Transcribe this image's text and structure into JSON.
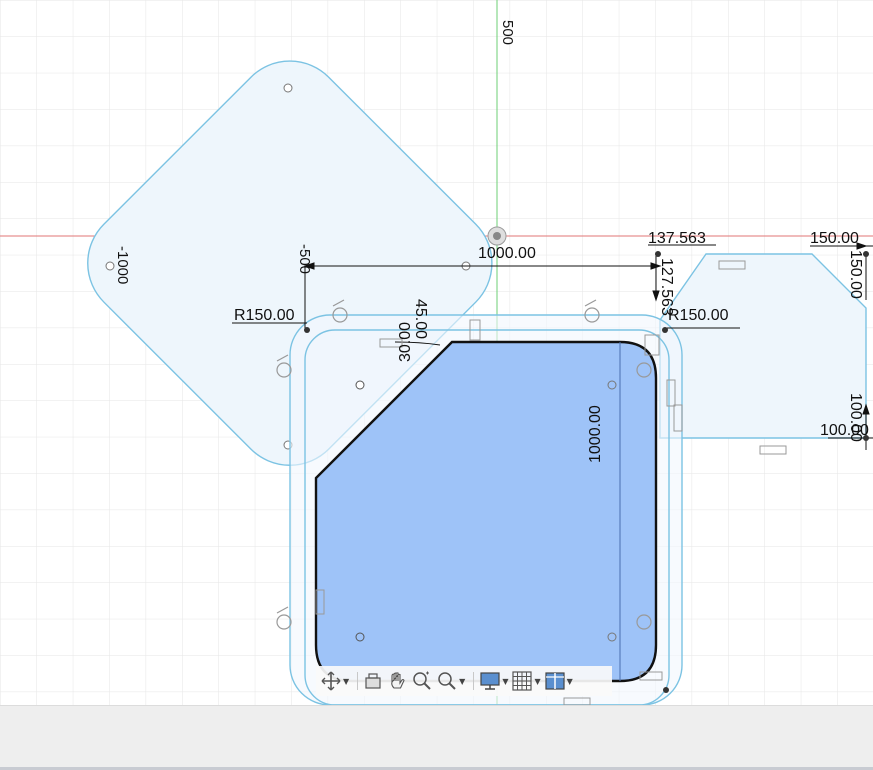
{
  "dims": {
    "d_1000_h": "1000.00",
    "d_137": "137.563",
    "d_127": "127.563",
    "d_150_top": "150.00",
    "d_150_right": "150.00",
    "d_r150_left": "R150.00",
    "d_r150_right": "R150.00",
    "d_45": "45.00",
    "d_30": "30.00",
    "d_1000_v": "1000.00",
    "d_100_h": "100.00",
    "d_100_v": "100.00"
  },
  "axes": {
    "x_500": "500",
    "y_m500": "-500",
    "y_m1000": "-1000"
  },
  "colors": {
    "sketch_line": "#7ac4e4",
    "fill_light": "#eef6fc",
    "profile_fill": "#9ec3f8",
    "x_axis": "#e0706f",
    "y_axis": "#5fcf6a",
    "grid": "#e3e3e3"
  },
  "toolbar": {
    "items": [
      "orbit-icon",
      "look-at-icon",
      "pan-icon",
      "zoom-icon",
      "fit-icon",
      "display-settings-icon",
      "grid-settings-icon",
      "viewports-icon"
    ]
  }
}
